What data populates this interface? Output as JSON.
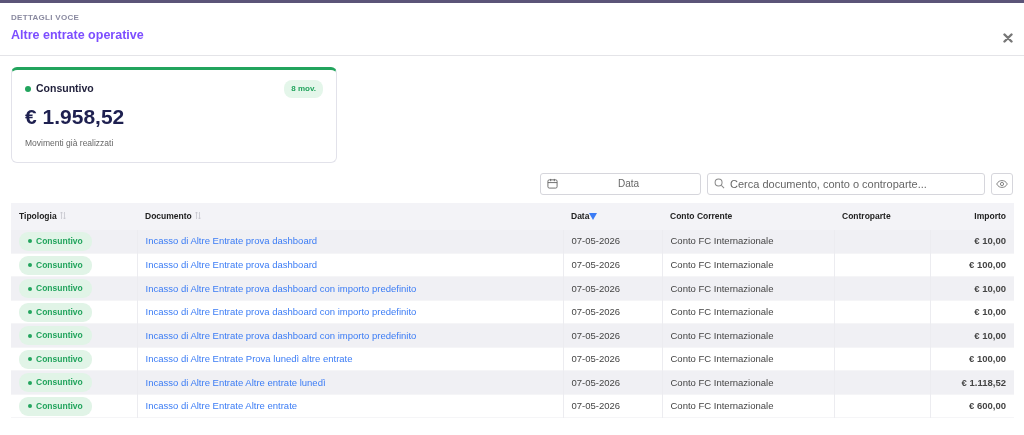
{
  "header": {
    "eyebrow": "DETTAGLI VOCE",
    "title": "Altre entrate operative"
  },
  "summary": {
    "label": "Consuntivo",
    "count": "8 mov.",
    "amount": "€ 1.958,52",
    "caption": "Movimenti già realizzati",
    "color": "#22a45d"
  },
  "filters": {
    "date_placeholder": "Data",
    "search_placeholder": "Cerca documento, conto o controparte..."
  },
  "table": {
    "columns": [
      {
        "label": "Tipologia",
        "sortable": true,
        "sorted": false
      },
      {
        "label": "Documento",
        "sortable": true,
        "sorted": false
      },
      {
        "label": "Data",
        "sortable": true,
        "sorted": true
      },
      {
        "label": "Conto Corrente",
        "sortable": false
      },
      {
        "label": "Controparte",
        "sortable": false
      },
      {
        "label": "Importo",
        "sortable": false
      }
    ],
    "rows": [
      {
        "type": "Consuntivo",
        "document": "Incasso di Altre Entrate prova dashboard",
        "date": "07-05-2026",
        "account": "Conto FC Internazionale",
        "amount": "€ 10,00"
      },
      {
        "type": "Consuntivo",
        "document": "Incasso di Altre Entrate prova dashboard",
        "date": "07-05-2026",
        "account": "Conto FC Internazionale",
        "amount": "€ 100,00"
      },
      {
        "type": "Consuntivo",
        "document": "Incasso di Altre Entrate prova dashboard con importo predefinito",
        "date": "07-05-2026",
        "account": "Conto FC Internazionale",
        "amount": "€ 10,00"
      },
      {
        "type": "Consuntivo",
        "document": "Incasso di Altre Entrate prova dashboard con importo predefinito",
        "date": "07-05-2026",
        "account": "Conto FC Internazionale",
        "amount": "€ 10,00"
      },
      {
        "type": "Consuntivo",
        "document": "Incasso di Altre Entrate prova dashboard con importo predefinito",
        "date": "07-05-2026",
        "account": "Conto FC Internazionale",
        "amount": "€ 10,00"
      },
      {
        "type": "Consuntivo",
        "document": "Incasso di Altre Entrate Prova lunedì altre entrate",
        "date": "07-05-2026",
        "account": "Conto FC Internazionale",
        "amount": "€ 100,00"
      },
      {
        "type": "Consuntivo",
        "document": "Incasso di Altre Entrate Altre entrate lunedì",
        "date": "07-05-2026",
        "account": "Conto FC Internazionale",
        "amount": "€ 1.118,52"
      },
      {
        "type": "Consuntivo",
        "document": "Incasso di Altre Entrate Altre entrate",
        "date": "07-05-2026",
        "account": "Conto FC Internazionale",
        "amount": "€ 600,00"
      }
    ]
  }
}
